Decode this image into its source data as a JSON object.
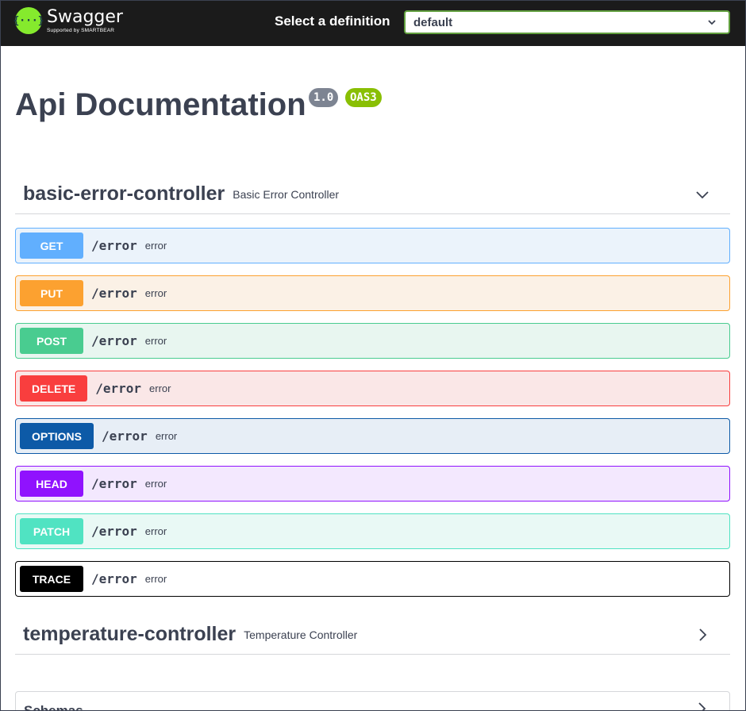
{
  "topbar": {
    "logo_glyph": "{···}",
    "logo_title": "Swagger",
    "logo_subtitle": "Supported by SMARTBEAR",
    "definition_label": "Select a definition",
    "definition_value": "default",
    "logo_color": "#85ea2d"
  },
  "info": {
    "title": "Api Documentation",
    "version": "1.0",
    "oas": "OAS3"
  },
  "tags": [
    {
      "name": "basic-error-controller",
      "description": "Basic Error Controller",
      "expanded": true,
      "icon": "chevron-down-icon"
    },
    {
      "name": "temperature-controller",
      "description": "Temperature Controller",
      "expanded": false,
      "icon": "chevron-right-icon"
    }
  ],
  "operations": [
    {
      "method": "GET",
      "path": "/error",
      "summary": "error",
      "color": "#61affe",
      "bg": "#ebf3fb"
    },
    {
      "method": "PUT",
      "path": "/error",
      "summary": "error",
      "color": "#fca130",
      "bg": "#fbf1e6"
    },
    {
      "method": "POST",
      "path": "/error",
      "summary": "error",
      "color": "#49cc90",
      "bg": "#e8f6f0"
    },
    {
      "method": "DELETE",
      "path": "/error",
      "summary": "error",
      "color": "#f93e3e",
      "bg": "#fae7e7"
    },
    {
      "method": "OPTIONS",
      "path": "/error",
      "summary": "error",
      "color": "#0d5aa7",
      "bg": "#e7eef6"
    },
    {
      "method": "HEAD",
      "path": "/error",
      "summary": "error",
      "color": "#9012fe",
      "bg": "#f3e8fe"
    },
    {
      "method": "PATCH",
      "path": "/error",
      "summary": "error",
      "color": "#50e3c2",
      "bg": "#e9f9f5"
    },
    {
      "method": "TRACE",
      "path": "/error",
      "summary": "error",
      "color": "#000000",
      "bg": "#ffffff"
    }
  ],
  "schemas": {
    "label": "Schemas"
  }
}
